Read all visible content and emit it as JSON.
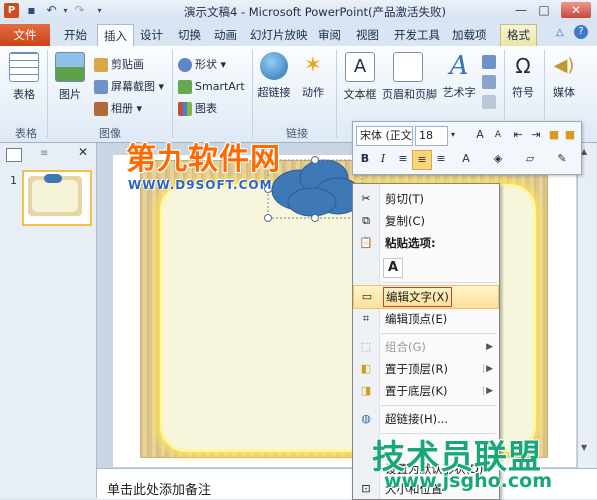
{
  "window": {
    "title": "演示文稿4 - Microsoft PowerPoint(产品激活失败)",
    "min_glyph": "—",
    "max_glyph": "□",
    "close_glyph": "✕"
  },
  "tabs": [
    {
      "label": "文件"
    },
    {
      "label": "开始"
    },
    {
      "label": "插入"
    },
    {
      "label": "设计"
    },
    {
      "label": "切换"
    },
    {
      "label": "动画"
    },
    {
      "label": "幻灯片放映"
    },
    {
      "label": "审阅"
    },
    {
      "label": "视图"
    },
    {
      "label": "开发工具"
    },
    {
      "label": "加载项"
    },
    {
      "label": "格式"
    }
  ],
  "ribbon": {
    "table": "表格",
    "picture": "图片",
    "clipart": "剪贴画",
    "screenshot": "屏幕截图",
    "album": "相册",
    "shapes": "形状",
    "smartart": "SmartArt",
    "chart": "图表",
    "hyperlink": "超链接",
    "action": "动作",
    "textbox": "文本框",
    "header_footer": "页眉和页脚",
    "wordart": "艺术字",
    "symbol": "符号",
    "media": "媒体",
    "group_table": "表格",
    "group_images": "图像",
    "group_links": "链接"
  },
  "mini_toolbar": {
    "font": "宋体 (正文",
    "size": "18",
    "bold": "B",
    "italic": "I"
  },
  "slide_pane": {
    "slide_number": "1"
  },
  "context_menu": {
    "cut": "剪切(T)",
    "copy": "复制(C)",
    "paste_options": "粘贴选项:",
    "paste_keep_text": "A",
    "edit_text": "编辑文字(X)",
    "edit_points": "编辑顶点(E)",
    "group": "组合(G)",
    "bring_front": "置于顶层(R)",
    "send_back": "置于底层(K)",
    "hyperlink": "超链接(H)...",
    "set_default": "设置为默认形状(D)",
    "size_position": "大小和位置"
  },
  "notes": {
    "placeholder": "单击此处添加备注"
  },
  "watermarks": {
    "d9_logo": "第九软件网",
    "d9_url": "WWW.D9SOFT.COM",
    "jsgho_logo": "技术员联盟",
    "jsgho_url": "www.jsgho.com"
  },
  "colors": {
    "file_tab": "#d1501f",
    "frame_glow": "#ffe65a",
    "cloud": "#3f78b6",
    "menu_highlight": "#fce199"
  }
}
